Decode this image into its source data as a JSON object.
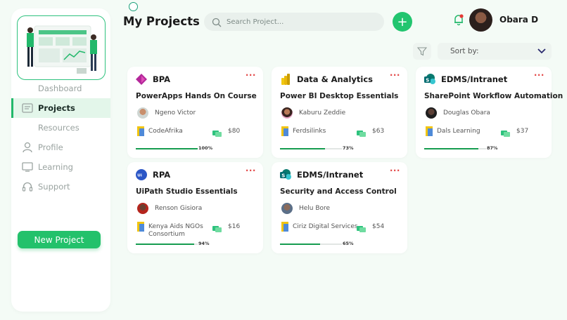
{
  "header": {
    "title": "My Projects",
    "search_placeholder": "Search Project...",
    "add_label": "+",
    "user_name": "Obara D",
    "sort_label": "Sort by:"
  },
  "sidebar": {
    "items": [
      {
        "label": "Dashboard",
        "icon": "grid-icon",
        "active": false
      },
      {
        "label": "Projects",
        "icon": "projects-icon",
        "active": true
      },
      {
        "label": "Resources",
        "icon": "folder-icon",
        "active": false
      },
      {
        "label": "Profile",
        "icon": "user-icon",
        "active": false
      },
      {
        "label": "Learning",
        "icon": "monitor-icon",
        "active": false
      },
      {
        "label": "Support",
        "icon": "headset-icon",
        "active": false
      }
    ],
    "new_project_label": "New Project"
  },
  "projects": [
    {
      "category": "BPA",
      "course": "PowerApps Hands On Course",
      "person": "Ngeno Victor",
      "org": "CodeAfrika",
      "price": "$80",
      "progress_label": "100%",
      "progress": 1.0
    },
    {
      "category": "Data & Analytics",
      "course": "Power BI Desktop Essentials",
      "person": "Kaburu Zeddie",
      "org": "Ferdsilinks",
      "price": "$63",
      "progress_label": "73%",
      "progress": 0.73
    },
    {
      "category": "EDMS/Intranet",
      "course": "SharePoint Workflow Automation",
      "person": "Douglas Obara",
      "org": "Dals Learning",
      "price": "$37",
      "progress_label": "87%",
      "progress": 0.87
    },
    {
      "category": "RPA",
      "course": "UiPath Studio Essentials",
      "person": "Renson Gisiora",
      "org": "Kenya Aids NGOs Consortium",
      "price": "$16",
      "progress_label": "94%",
      "progress": 0.94
    },
    {
      "category": "EDMS/Intranet",
      "course": "Security and Access Control",
      "person": "Helu Bore",
      "org": "Ciriz Digital Services",
      "price": "$54",
      "progress_label": "65%",
      "progress": 0.65
    }
  ],
  "colors": {
    "accent": "#23c16b",
    "progress": "#169c50",
    "menu_dots": "#e34a4a"
  }
}
